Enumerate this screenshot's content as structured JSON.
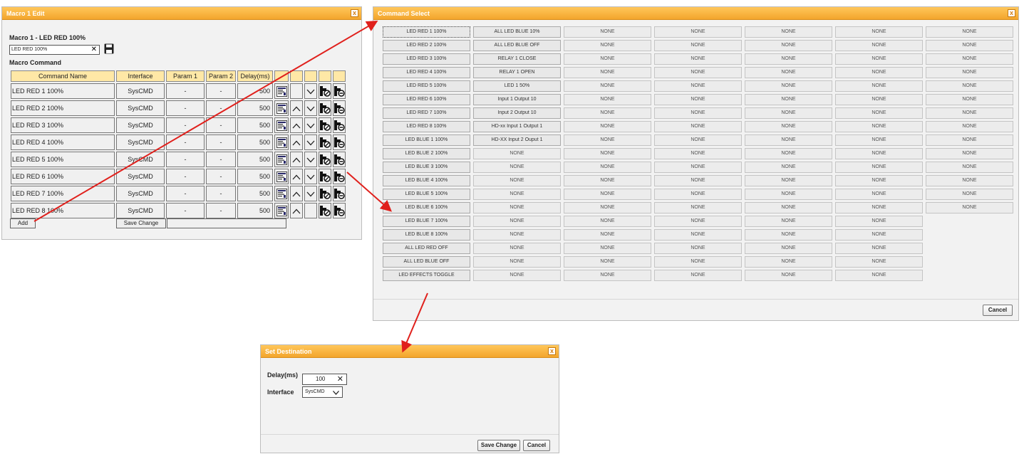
{
  "macro_edit": {
    "title": "Macro 1 Edit",
    "close_label": "x",
    "heading": "Macro 1 - LED RED 100%",
    "name_value": "LED RED 100%",
    "clear_label": "✕",
    "subheading": "Macro Command",
    "columns": [
      "Command Name",
      "Interface",
      "Param 1",
      "Param 2",
      "Delay(ms)"
    ],
    "rows": [
      {
        "name": "LED RED 1 100%",
        "interface": "SysCMD",
        "p1": "-",
        "p2": "-",
        "delay": "500",
        "up": false,
        "down": true
      },
      {
        "name": "LED RED 2 100%",
        "interface": "SysCMD",
        "p1": "-",
        "p2": "-",
        "delay": "500",
        "up": true,
        "down": true
      },
      {
        "name": "LED RED 3 100%",
        "interface": "SysCMD",
        "p1": "-",
        "p2": "-",
        "delay": "500",
        "up": true,
        "down": true
      },
      {
        "name": "LED RED 4 100%",
        "interface": "SysCMD",
        "p1": "-",
        "p2": "-",
        "delay": "500",
        "up": true,
        "down": true
      },
      {
        "name": "LED RED 5 100%",
        "interface": "SysCMD",
        "p1": "-",
        "p2": "-",
        "delay": "500",
        "up": true,
        "down": true
      },
      {
        "name": "LED RED 6 100%",
        "interface": "SysCMD",
        "p1": "-",
        "p2": "-",
        "delay": "500",
        "up": true,
        "down": true
      },
      {
        "name": "LED RED 7 100%",
        "interface": "SysCMD",
        "p1": "-",
        "p2": "-",
        "delay": "500",
        "up": true,
        "down": true
      },
      {
        "name": "LED RED 8 100%",
        "interface": "SysCMD",
        "p1": "-",
        "p2": "-",
        "delay": "500",
        "up": true,
        "down": false
      }
    ],
    "add_label": "Add",
    "save_change_label": "Save Change"
  },
  "command_select": {
    "title": "Command Select",
    "close_label": "x",
    "columns": [
      [
        "LED RED 1 100%",
        "LED RED 2 100%",
        "LED RED 3 100%",
        "LED RED 4 100%",
        "LED RED 5 100%",
        "LED RED 6 100%",
        "LED RED 7 100%",
        "LED RED 8 100%",
        "LED BLUE 1 100%",
        "LED BLUE 2 100%",
        "LED BLUE 3 100%",
        "LED BLUE 4 100%",
        "LED BLUE 5 100%",
        "LED BLUE 6 100%",
        "LED BLUE 7 100%",
        "LED BLUE 8 100%",
        "ALL LED RED OFF",
        "ALL LED BLUE OFF",
        "LED EFFECTS TOGGLE"
      ],
      [
        "ALL LED BLUE 10%",
        "ALL LED BLUE OFF",
        "RELAY 1 CLOSE",
        "RELAY 1 OPEN",
        "LED 1 50%",
        "Input 1 Output 10",
        "Input 2 Output 10",
        "HD-xx Input 1 Output 1",
        "HD-XX Input 2 Ouput 1",
        "NONE",
        "NONE",
        "NONE",
        "NONE",
        "NONE",
        "NONE",
        "NONE",
        "NONE",
        "NONE",
        "NONE"
      ],
      [
        "NONE",
        "NONE",
        "NONE",
        "NONE",
        "NONE",
        "NONE",
        "NONE",
        "NONE",
        "NONE",
        "NONE",
        "NONE",
        "NONE",
        "NONE",
        "NONE",
        "NONE",
        "NONE",
        "NONE",
        "NONE",
        "NONE"
      ],
      [
        "NONE",
        "NONE",
        "NONE",
        "NONE",
        "NONE",
        "NONE",
        "NONE",
        "NONE",
        "NONE",
        "NONE",
        "NONE",
        "NONE",
        "NONE",
        "NONE",
        "NONE",
        "NONE",
        "NONE",
        "NONE",
        "NONE"
      ],
      [
        "NONE",
        "NONE",
        "NONE",
        "NONE",
        "NONE",
        "NONE",
        "NONE",
        "NONE",
        "NONE",
        "NONE",
        "NONE",
        "NONE",
        "NONE",
        "NONE",
        "NONE",
        "NONE",
        "NONE",
        "NONE",
        "NONE"
      ],
      [
        "NONE",
        "NONE",
        "NONE",
        "NONE",
        "NONE",
        "NONE",
        "NONE",
        "NONE",
        "NONE",
        "NONE",
        "NONE",
        "NONE",
        "NONE",
        "NONE",
        "NONE",
        "NONE",
        "NONE",
        "NONE",
        "NONE"
      ],
      [
        "NONE",
        "NONE",
        "NONE",
        "NONE",
        "NONE",
        "NONE",
        "NONE",
        "NONE",
        "NONE",
        "NONE",
        "NONE",
        "NONE",
        "NONE",
        "NONE"
      ]
    ],
    "cancel_label": "Cancel"
  },
  "set_destination": {
    "title": "Set Destination",
    "close_label": "x",
    "delay_label": "Delay(ms)",
    "delay_value": "100",
    "clear_label": "✕",
    "interface_label": "Interface",
    "interface_value": "SysCMD",
    "save_change_label": "Save Change",
    "cancel_label": "Cancel"
  },
  "colors": {
    "titlebar": "#f3a52c",
    "header_cell": "#ffe8a6",
    "arrow": "#e0201c"
  }
}
